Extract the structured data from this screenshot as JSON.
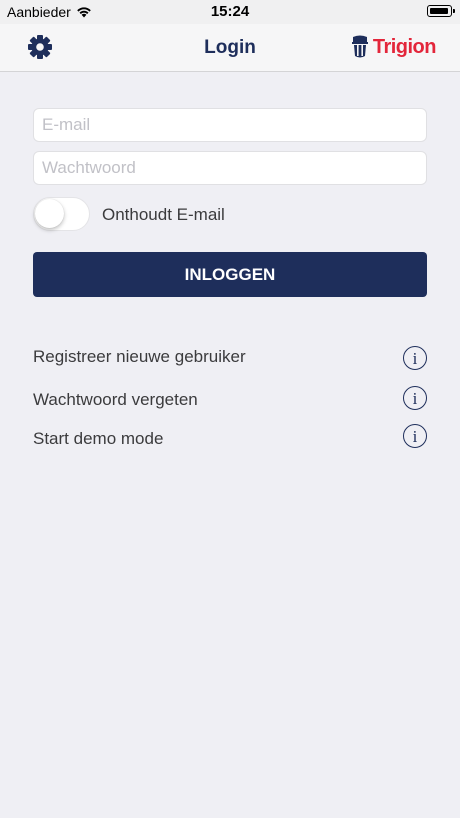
{
  "status_bar": {
    "carrier": "Aanbieder",
    "time": "15:24"
  },
  "nav": {
    "title": "Login",
    "brand": "Trigion",
    "brand_color": "#e3263b",
    "accent_color": "#1e2e5b",
    "left_icon": "gear-icon"
  },
  "form": {
    "email_placeholder": "E-mail",
    "email_value": "",
    "password_placeholder": "Wachtwoord",
    "password_value": "",
    "remember_label": "Onthoudt E-mail",
    "remember_on": false,
    "login_label": "INLOGGEN"
  },
  "links": [
    {
      "label": "Registreer nieuwe gebruiker",
      "icon": "info-icon"
    },
    {
      "label": "Wachtwoord vergeten",
      "icon": "info-icon"
    },
    {
      "label": "Start demo mode",
      "icon": "info-icon"
    }
  ],
  "info_glyph": "i"
}
